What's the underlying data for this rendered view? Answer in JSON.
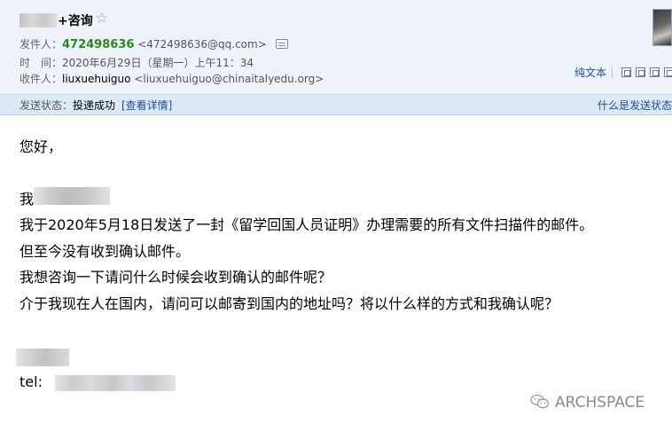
{
  "header": {
    "subject_suffix": "+咨询",
    "star_glyph": "☆",
    "sender": {
      "label": "发件人：",
      "qq_number": "472498636",
      "email": "<472498636@qq.com>"
    },
    "time": {
      "label": "时　间：",
      "value": "2020年6月29日（星期一）上午11：34"
    },
    "recipient": {
      "label": "收件人：",
      "name": "liuxuehuiguo",
      "email": "<liuxuehuiguo@chinaitalyedu.org>"
    },
    "plain_text_link": "纯文本"
  },
  "status_bar": {
    "label": "发送状态：",
    "value": "投递成功",
    "detail_link": "[查看详情]",
    "help_link": "什么是发送状态"
  },
  "mail_body": {
    "greeting": "您好，",
    "line_intro_prefix": "我",
    "line_1": "我于2020年5月18日发送了一封《留学回国人员证明》办理需要的所有文件扫描件的邮件。",
    "line_2": "但至今没有收到确认邮件。",
    "line_3": "我想咨询一下请问什么时候会收到确认的邮件呢？",
    "line_4": "介于我现在人在国内，请问可以邮寄到国内的地址吗？将以什么样的方式和我确认呢？",
    "tel_label": "tel:"
  },
  "watermark": {
    "text": "ARCHSPACE"
  },
  "colors": {
    "header_bg": "#eef3fa",
    "status_bar_bg": "#dde8f6",
    "sender_qq": "#2d8a18",
    "link": "#1d4f97"
  }
}
